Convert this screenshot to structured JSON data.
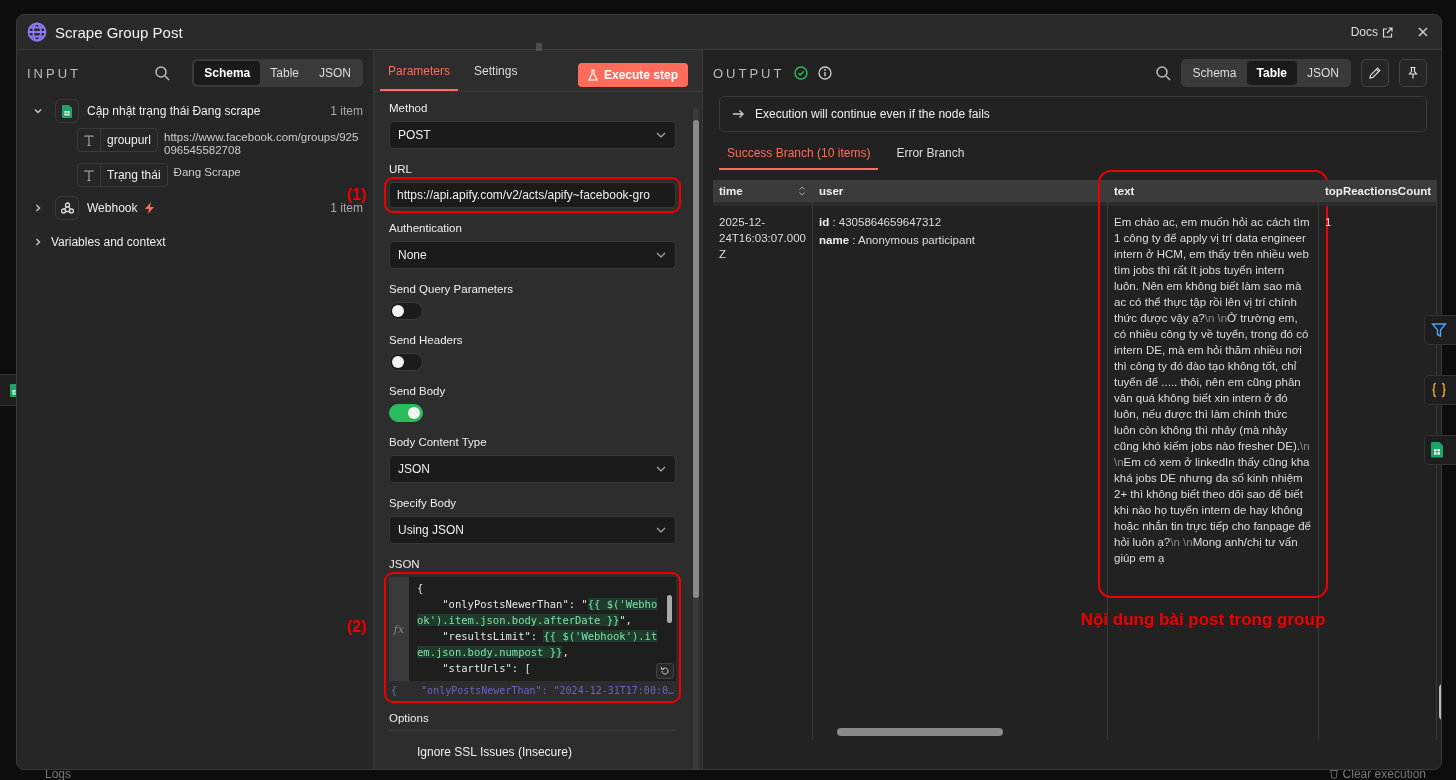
{
  "app": {
    "logs_label": "Logs",
    "clear_label": "Clear execution"
  },
  "window": {
    "title": "Scrape Group Post",
    "docs_label": "Docs"
  },
  "input": {
    "heading": "INPUT",
    "view_tabs": [
      {
        "label": "Schema",
        "selected": true
      },
      {
        "label": "Table",
        "selected": false
      },
      {
        "label": "JSON",
        "selected": false
      }
    ],
    "nodes": [
      {
        "kind": "sheet",
        "label": "Cập nhật trạng thái Đang scrape",
        "count": "1 item",
        "expanded": true,
        "trigger": false,
        "fields": [
          {
            "name": "groupurl",
            "value": "https://www.facebook.com/groups/925096545582708"
          },
          {
            "name": "Trạng thái",
            "value": "Đang Scrape"
          }
        ]
      },
      {
        "kind": "webhook",
        "label": "Webhook",
        "count": "1 item",
        "expanded": false,
        "trigger": true
      }
    ],
    "variables": {
      "label": "Variables and context",
      "expanded": false
    }
  },
  "parameters": {
    "tabs": [
      {
        "label": "Parameters",
        "selected": true
      },
      {
        "label": "Settings",
        "selected": false
      }
    ],
    "execute_label": "Execute step",
    "fields": [
      {
        "kind": "select",
        "label": "Method",
        "value": "POST"
      },
      {
        "kind": "input",
        "label": "URL",
        "value": "https://api.apify.com/v2/acts/apify~facebook-gro",
        "annotation": "(1)"
      },
      {
        "kind": "select",
        "label": "Authentication",
        "value": "None"
      },
      {
        "kind": "toggle",
        "label": "Send Query Parameters",
        "on": false
      },
      {
        "kind": "toggle",
        "label": "Send Headers",
        "on": false
      },
      {
        "kind": "toggle",
        "label": "Send Body",
        "on": true
      },
      {
        "kind": "select",
        "label": "Body Content Type",
        "value": "JSON"
      },
      {
        "kind": "select",
        "label": "Specify Body",
        "value": "Using JSON"
      },
      {
        "kind": "code",
        "label": "JSON",
        "annotation": "(2)",
        "gutter": "fx",
        "lines": [
          [
            {
              "text": "{",
              "expr": false
            }
          ],
          [
            {
              "text": "    \"onlyPostsNewerThan\": \"",
              "expr": false
            },
            {
              "text": "{{ $('Webhook').item.json.body.afterDate }}",
              "expr": true
            },
            {
              "text": "\",",
              "expr": false
            }
          ],
          [
            {
              "text": "    \"resultsLimit\": ",
              "expr": false
            },
            {
              "text": "{{ $('Webhook').item.json.body.numpost }}",
              "expr": true
            },
            {
              "text": ",",
              "expr": false
            }
          ],
          [
            {
              "text": "    \"startUrls\": [",
              "expr": false
            }
          ]
        ],
        "preview": "{    \"onlyPostsNewerThan\": \"2024-12-31T17:00:0…"
      }
    ],
    "options": {
      "label": "Options",
      "items": [
        "Ignore SSL Issues (Insecure)"
      ]
    }
  },
  "output": {
    "heading": "OUTPUT",
    "success": true,
    "view_tabs": [
      {
        "label": "Schema",
        "selected": false
      },
      {
        "label": "Table",
        "selected": true
      },
      {
        "label": "JSON",
        "selected": false
      }
    ],
    "notice": "Execution will continue even if the node fails",
    "branches": [
      {
        "label": "Success Branch (10 items)",
        "selected": true
      },
      {
        "label": "Error Branch",
        "selected": false
      }
    ],
    "table": {
      "columns": [
        {
          "label": "time",
          "sortable": true,
          "highlighted": false
        },
        {
          "label": "user",
          "sortable": false,
          "highlighted": false
        },
        {
          "label": "text",
          "sortable": false,
          "highlighted": true
        },
        {
          "label": "topReactionsCount",
          "sortable": false,
          "highlighted": false
        }
      ],
      "rows": [
        {
          "cells": [
            {
              "kind": "plain",
              "text": "2025-12-24T16:03:07.000Z"
            },
            {
              "kind": "pairs",
              "pairs": [
                {
                  "key": "id",
                  "separator": ":",
                  "value": "4305864659647312"
                },
                {
                  "key": "name",
                  "separator": ":",
                  "value": "Anonymous participant"
                }
              ]
            },
            {
              "kind": "parts",
              "parts": [
                {
                  "kind": "text",
                  "text": "Em chào ac, em muốn hỏi ac cách tìm 1 công ty để apply vị trí data engineer intern ở HCM, em thấy trên nhiều web tìm jobs thì rất ít jobs tuyển intern luôn. Nên em không biết làm sao mà ac có thể thực tập rồi lên vị trí chính thức được vậy ạ?"
                },
                {
                  "kind": "escape",
                  "text": "\\n \\n"
                },
                {
                  "kind": "text",
                  "text": "Ở trường em, có nhiều công ty về tuyển, trong đó có intern DE, mà em hỏi thăm nhiều nơi thì công ty đó đào tạo không tốt, chỉ tuyển để ..... thôi, nên em cũng phân vân quá không biết xin intern ở đó luôn, nếu được thì làm chính thức luôn còn không thì nhảy (mà nhảy cũng khó kiếm jobs nào fresher DE)."
                },
                {
                  "kind": "escape",
                  "text": "\\n \\n"
                },
                {
                  "kind": "text",
                  "text": "Em có xem ở linkedIn thấy cũng kha khá jobs DE nhưng đa số kinh nhiệm 2+ thì không biết theo dõi sao để biết khi nào họ tuyển intern de hay không hoặc nhắn tin trực tiếp cho fanpage để hỏi luôn ạ?"
                },
                {
                  "kind": "escape",
                  "text": "\\n \\n"
                },
                {
                  "kind": "text",
                  "text": "Mong anh/chị tư vấn giúp em ạ"
                }
              ]
            },
            {
              "kind": "plain",
              "text": "1"
            }
          ]
        }
      ]
    },
    "annotation_caption": "Nội dung bài post trong group"
  }
}
